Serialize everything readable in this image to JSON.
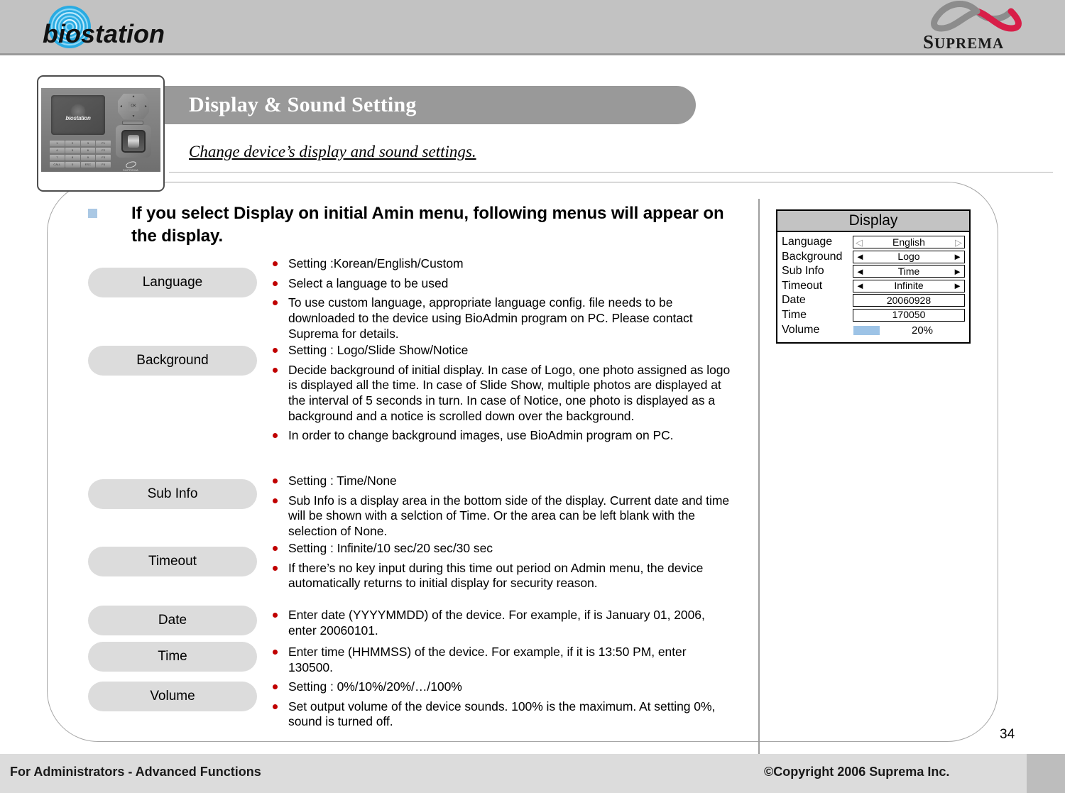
{
  "banner": {
    "product_logo": "biostation",
    "company_logo": "SUPREMA"
  },
  "device_photo": {
    "screen_label": "biostation",
    "nav_ok": "OK",
    "nav_up": "▲",
    "nav_down": "▼",
    "nav_left": "◄",
    "nav_right": "►",
    "keypad": [
      [
        "1",
        "2",
        "3",
        "F1"
      ],
      [
        "4",
        "5",
        "6",
        "F2"
      ],
      [
        "7",
        "8",
        "9",
        "F3"
      ],
      [
        "CALL",
        "0",
        "ESC",
        "F4"
      ]
    ],
    "brand": "SUPREMA"
  },
  "header": {
    "title": "Display & Sound Setting",
    "subtitle": "Change device’s display and sound settings."
  },
  "headline": "If you select Display on initial Amin menu, following menus will appear on the display.",
  "sections": [
    {
      "pill": "Language",
      "bullets": [
        "Setting :Korean/English/Custom",
        "Select a language to be used",
        "To use custom language, appropriate language config. file needs to be downloaded to the device using BioAdmin program on PC. Please contact Suprema for details."
      ]
    },
    {
      "pill": "Background",
      "bullets": [
        "Setting : Logo/Slide Show/Notice",
        "Decide background of initial display. In case of Logo, one photo assigned as logo is displayed all the time. In case of Slide Show, multiple photos are displayed at the interval of 5 seconds in turn. In case of Notice, one photo is displayed as a background and a notice is scrolled down over the background.",
        "In order to change background images, use BioAdmin program on PC."
      ]
    },
    {
      "pill": "Sub Info",
      "bullets": [
        "Setting : Time/None",
        "Sub Info is a display area in the bottom side of the display. Current date and time will be shown with a selction of Time. Or the area can be left blank with the selection of None."
      ]
    },
    {
      "pill": "Timeout",
      "bullets": [
        "Setting : Infinite/10 sec/20 sec/30 sec",
        "If there’s no key input during this time out period on Admin menu, the device automatically returns to initial display for security reason."
      ]
    },
    {
      "pill": "Date",
      "bullets": [
        "Enter date (YYYYMMDD) of the device.  For example, if is January 01, 2006, enter 20060101."
      ]
    },
    {
      "pill": "Time",
      "bullets": [
        "Enter time (HHMMSS) of the device. For example, if it is 13:50 PM, enter 130500."
      ]
    },
    {
      "pill": "Volume",
      "bullets": [
        "Setting : 0%/10%/20%/…/100%",
        "Set output volume of the device sounds. 100% is the maximum. At setting 0%, sound is turned off."
      ]
    }
  ],
  "display_panel": {
    "title": "Display",
    "arrow_left": "◄",
    "arrow_right": "►",
    "arrow_left_dim": "◁",
    "arrow_right_dim": "▷",
    "rows": [
      {
        "label": "Language",
        "value": "English",
        "type": "stepper-dim"
      },
      {
        "label": "Background",
        "value": "Logo",
        "type": "stepper"
      },
      {
        "label": "Sub Info",
        "value": "Time",
        "type": "stepper"
      },
      {
        "label": "Timeout",
        "value": "Infinite",
        "type": "stepper"
      },
      {
        "label": "Date",
        "value": "20060928",
        "type": "plain"
      },
      {
        "label": "Time",
        "value": "170050",
        "type": "plain"
      },
      {
        "label": "Volume",
        "value": "20%",
        "type": "volume",
        "bar_percent": 20
      }
    ]
  },
  "footer": {
    "left": "For Administrators - Advanced Functions",
    "right": "©Copyright 2006 Suprema Inc.",
    "page_number": "34"
  },
  "colors": {
    "banner": "#c2c2c2",
    "title_bar": "#999999",
    "pill": "#dcdcdc",
    "bullet_red": "#c00000",
    "square_bullet_blue": "#aac8e4",
    "volume_bar_blue": "#9dc3e6",
    "panel_header_gray": "#c3c3c3",
    "footer": "#dcdcdc"
  }
}
